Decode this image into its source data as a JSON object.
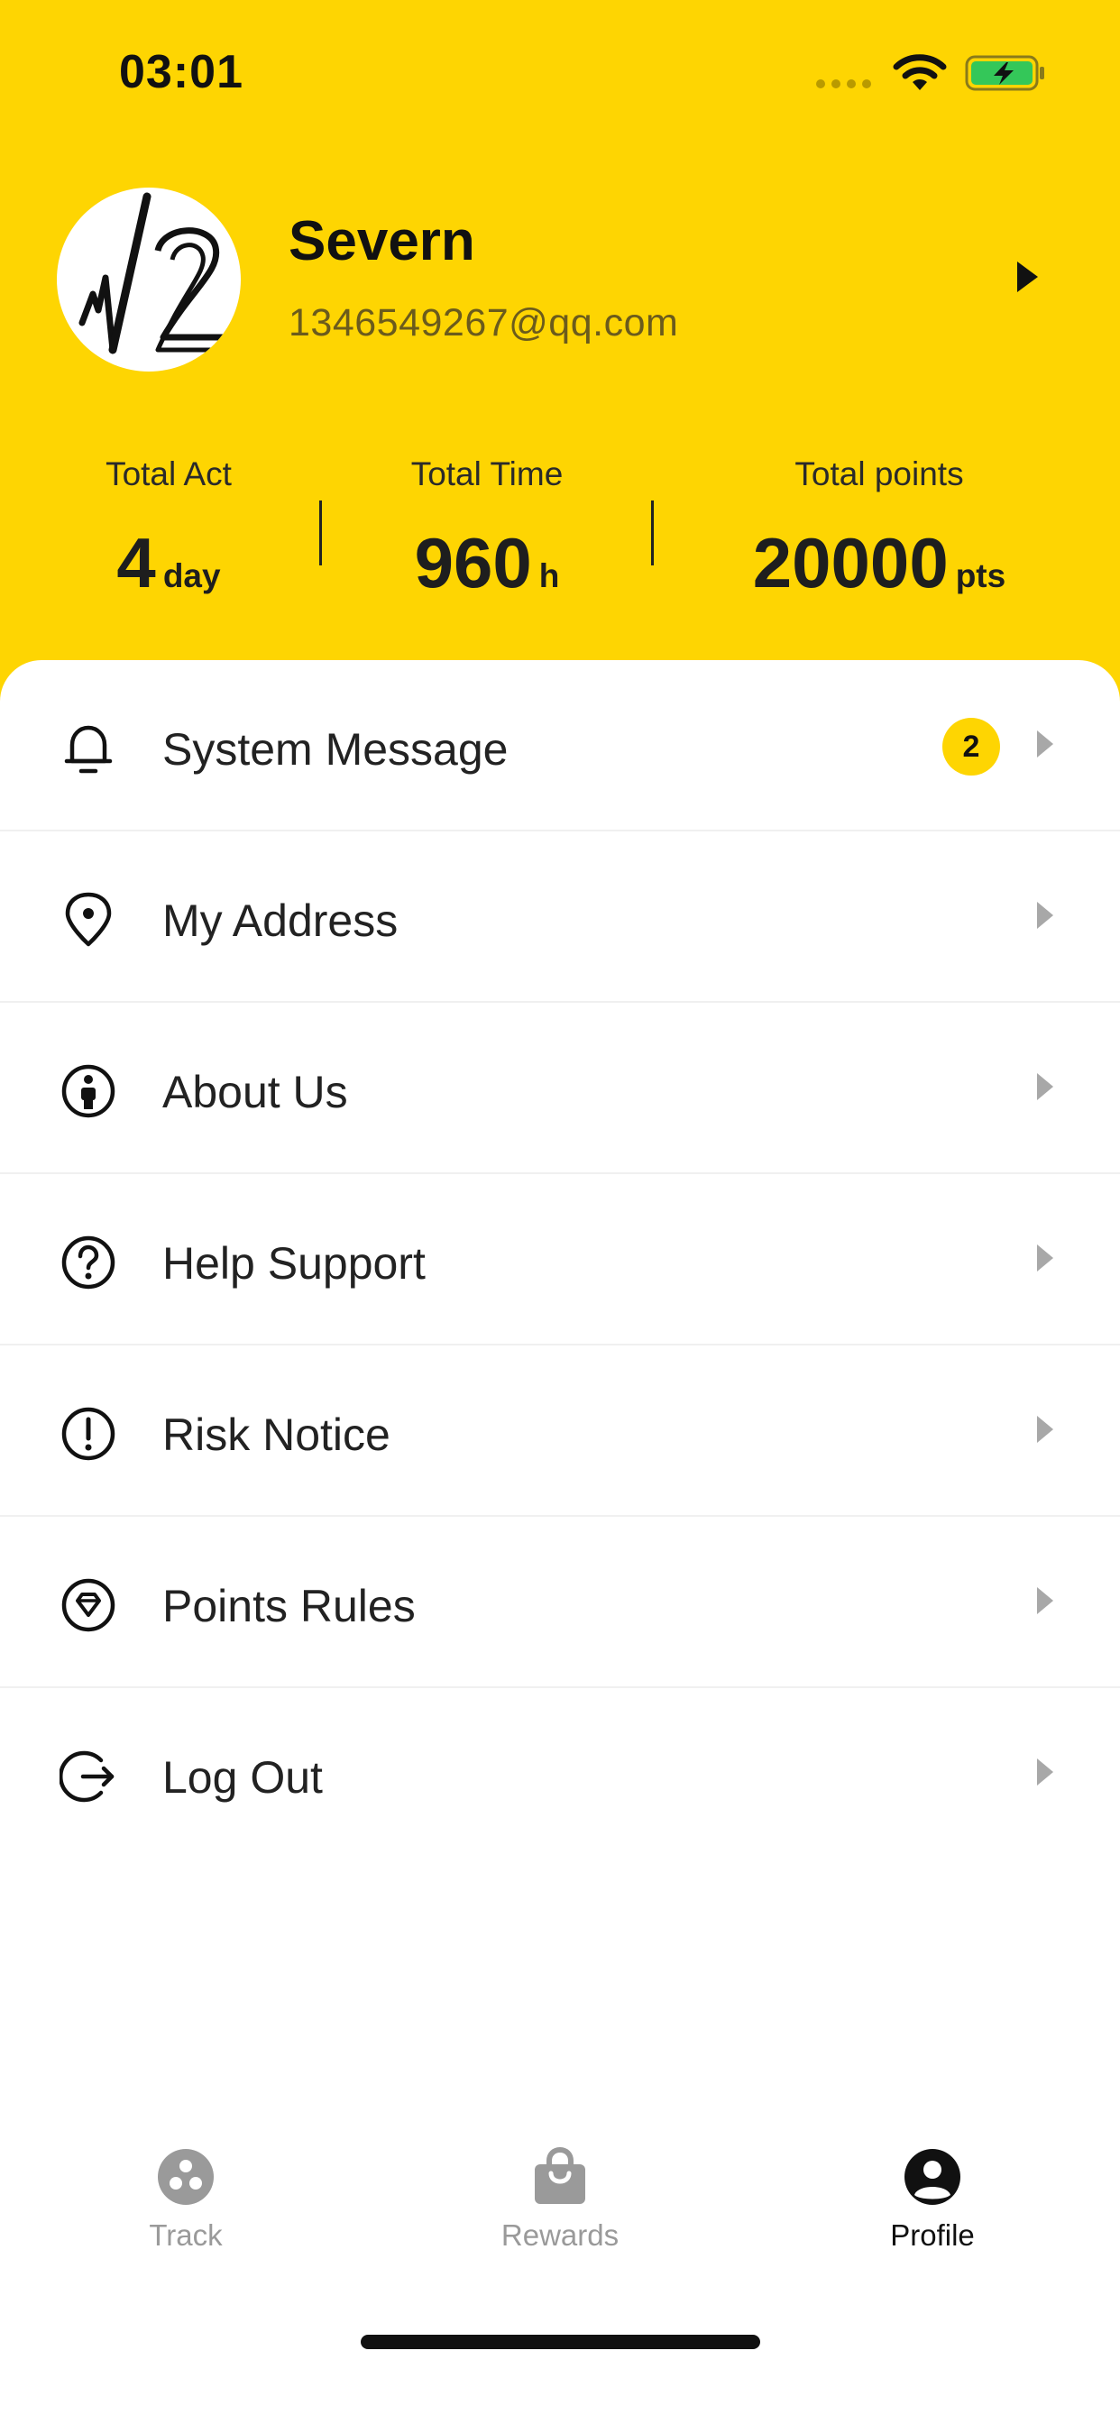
{
  "status_bar": {
    "time": "03:01"
  },
  "profile": {
    "name": "Severn",
    "email": "1346549267@qq.com"
  },
  "stats": [
    {
      "label": "Total Act",
      "value": "4",
      "unit": "day"
    },
    {
      "label": "Total Time",
      "value": "960",
      "unit": "h"
    },
    {
      "label": "Total points",
      "value": "20000",
      "unit": "pts"
    }
  ],
  "menu": {
    "items": [
      {
        "label": "System Message",
        "icon": "bell-icon",
        "badge": "2"
      },
      {
        "label": "My Address",
        "icon": "location-pin-icon"
      },
      {
        "label": "About Us",
        "icon": "info-person-icon"
      },
      {
        "label": "Help Support",
        "icon": "question-icon"
      },
      {
        "label": "Risk Notice",
        "icon": "exclamation-icon"
      },
      {
        "label": "Points Rules",
        "icon": "diamond-icon"
      },
      {
        "label": "Log Out",
        "icon": "logout-icon"
      }
    ]
  },
  "tabbar": {
    "tabs": [
      {
        "label": "Track",
        "icon": "track-icon",
        "active": false
      },
      {
        "label": "Rewards",
        "icon": "shopping-bag-icon",
        "active": false
      },
      {
        "label": "Profile",
        "icon": "user-circle-icon",
        "active": true
      }
    ]
  },
  "colors": {
    "brand_yellow": "#FED502",
    "text_dark": "#111111",
    "tab_inactive": "#9A9A9A",
    "battery_green": "#34C759"
  }
}
